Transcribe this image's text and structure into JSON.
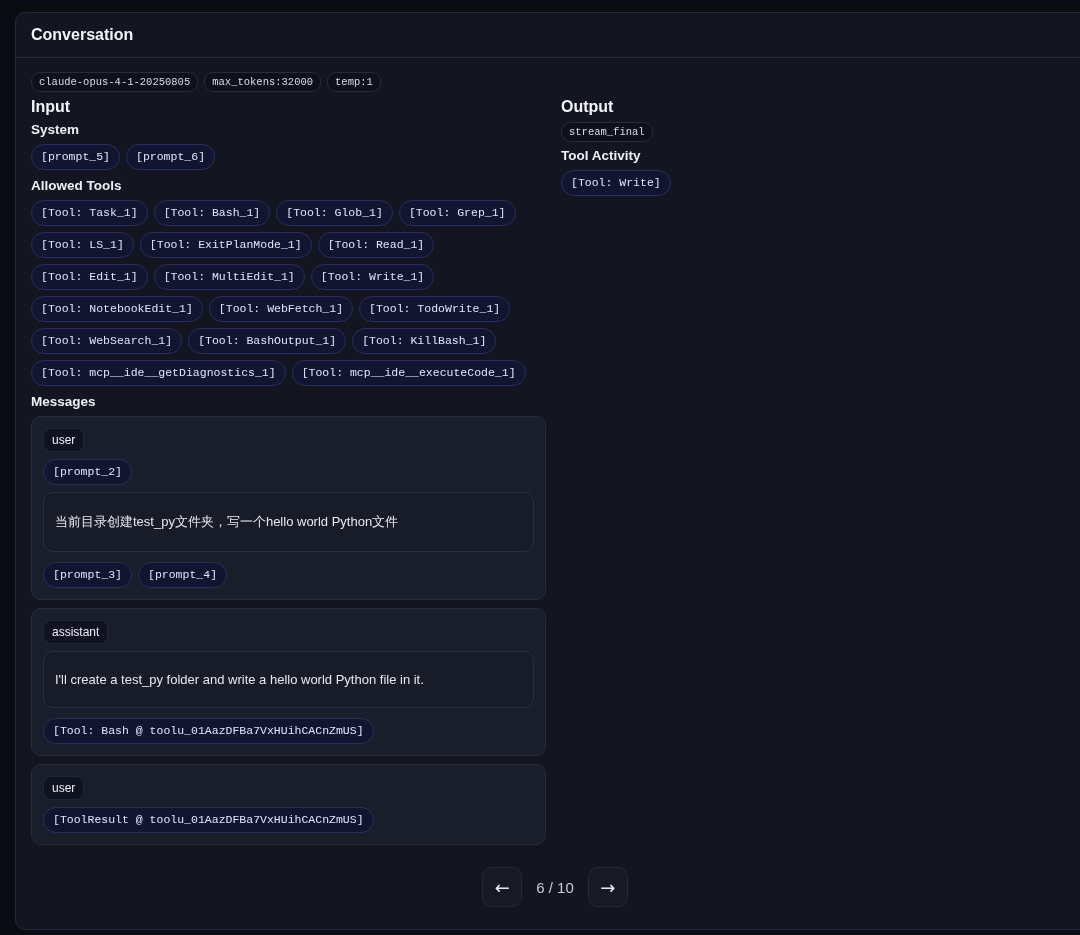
{
  "panel": {
    "title": "Conversation"
  },
  "meta_tags": [
    "claude-opus-4-1-20250805",
    "max_tokens:32000",
    "temp:1"
  ],
  "input": {
    "heading": "Input",
    "system": {
      "heading": "System",
      "chips": [
        "[prompt_5]",
        "[prompt_6]"
      ]
    },
    "allowed_tools": {
      "heading": "Allowed Tools",
      "chips": [
        "[Tool: Task_1]",
        "[Tool: Bash_1]",
        "[Tool: Glob_1]",
        "[Tool: Grep_1]",
        "[Tool: LS_1]",
        "[Tool: ExitPlanMode_1]",
        "[Tool: Read_1]",
        "[Tool: Edit_1]",
        "[Tool: MultiEdit_1]",
        "[Tool: Write_1]",
        "[Tool: NotebookEdit_1]",
        "[Tool: WebFetch_1]",
        "[Tool: TodoWrite_1]",
        "[Tool: WebSearch_1]",
        "[Tool: BashOutput_1]",
        "[Tool: KillBash_1]",
        "[Tool: mcp__ide__getDiagnostics_1]",
        "[Tool: mcp__ide__executeCode_1]"
      ]
    },
    "messages": {
      "heading": "Messages",
      "items": [
        {
          "role": "user",
          "blocks": [
            {
              "kind": "chips",
              "chips": [
                "[prompt_2]"
              ]
            },
            {
              "kind": "text",
              "text": "当前目录创建test_py文件夹，写一个hello world Python文件"
            },
            {
              "kind": "chips",
              "chips": [
                "[prompt_3]",
                "[prompt_4]"
              ]
            }
          ]
        },
        {
          "role": "assistant",
          "blocks": [
            {
              "kind": "text",
              "text": "I'll create a test_py folder and write a hello world Python file in it."
            },
            {
              "kind": "chips",
              "chips": [
                "[Tool: Bash @ toolu_01AazDFBa7VxHUihCACnZmUS]"
              ]
            }
          ]
        },
        {
          "role": "user",
          "blocks": [
            {
              "kind": "chips",
              "chips": [
                "[ToolResult @ toolu_01AazDFBa7VxHUihCACnZmUS]"
              ]
            }
          ]
        }
      ]
    }
  },
  "output": {
    "heading": "Output",
    "tag": "stream_final",
    "tool_activity": {
      "heading": "Tool Activity",
      "chips": [
        "[Tool: Write]"
      ]
    }
  },
  "pager": {
    "prev": "←",
    "position": "6 / 10",
    "next": "→"
  }
}
